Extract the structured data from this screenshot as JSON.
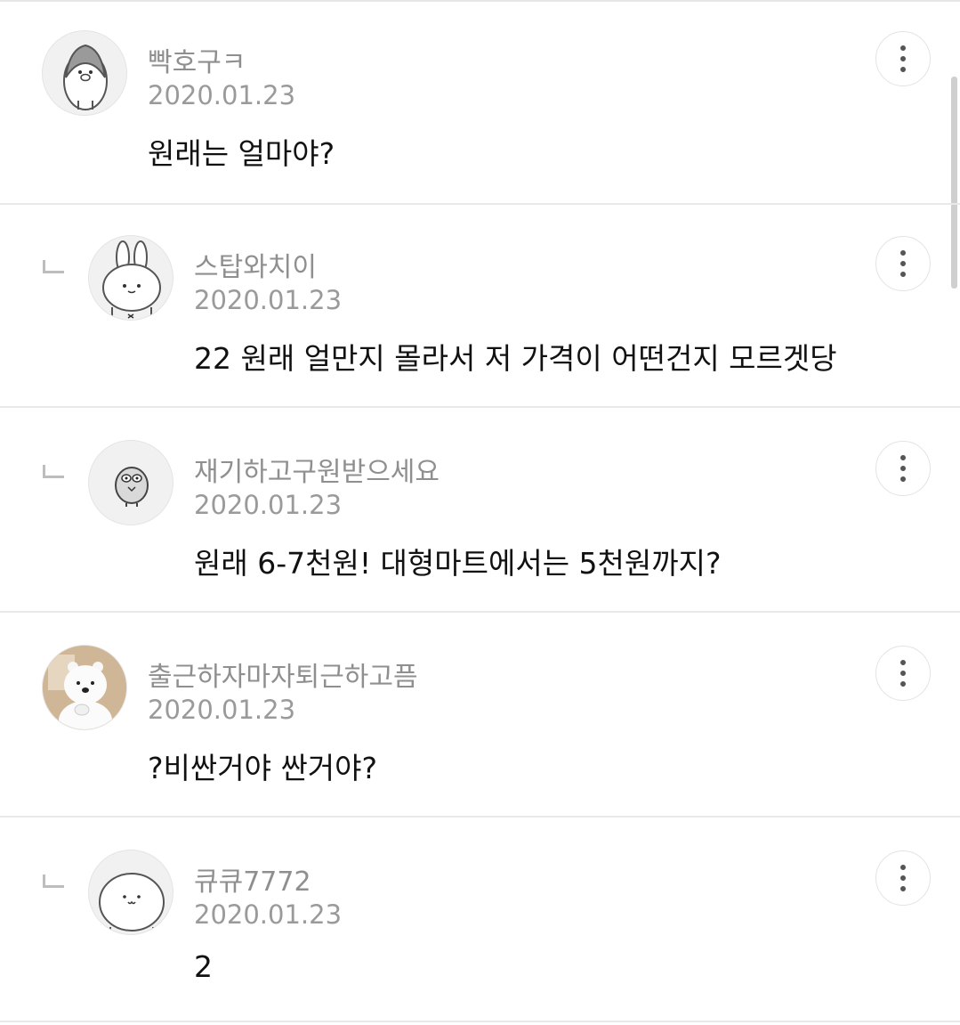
{
  "comments": [
    {
      "username": "빡호구ㅋ",
      "date": "2020.01.23",
      "text": "원래는 얼마야?",
      "is_reply": false,
      "avatar_icon": "penguin-avatar-icon"
    },
    {
      "username": "스탑와치이",
      "date": "2020.01.23",
      "text": "22 원래 얼만지 몰라서 저 가격이 어떤건지 모르겟당",
      "is_reply": true,
      "avatar_icon": "rabbit-avatar-icon"
    },
    {
      "username": "재기하고구원받으세요",
      "date": "2020.01.23",
      "text": "원래 6-7천원! 대형마트에서는 5천원까지?",
      "is_reply": true,
      "avatar_icon": "bird-avatar-icon"
    },
    {
      "username": "출근하자마자퇴근하고픔",
      "date": "2020.01.23",
      "text": "?비싼거야 싼거야?",
      "is_reply": false,
      "avatar_icon": "polar-bear-avatar-icon"
    },
    {
      "username": "큐큐7772",
      "date": "2020.01.23",
      "text": "2",
      "is_reply": true,
      "avatar_icon": "blob-avatar-icon"
    }
  ],
  "colors": {
    "username": "#8f8f8f",
    "date": "#9a9a9a",
    "text": "#111111",
    "divider": "#e9e9e9"
  },
  "more_button_icon": "more-vertical-icon"
}
